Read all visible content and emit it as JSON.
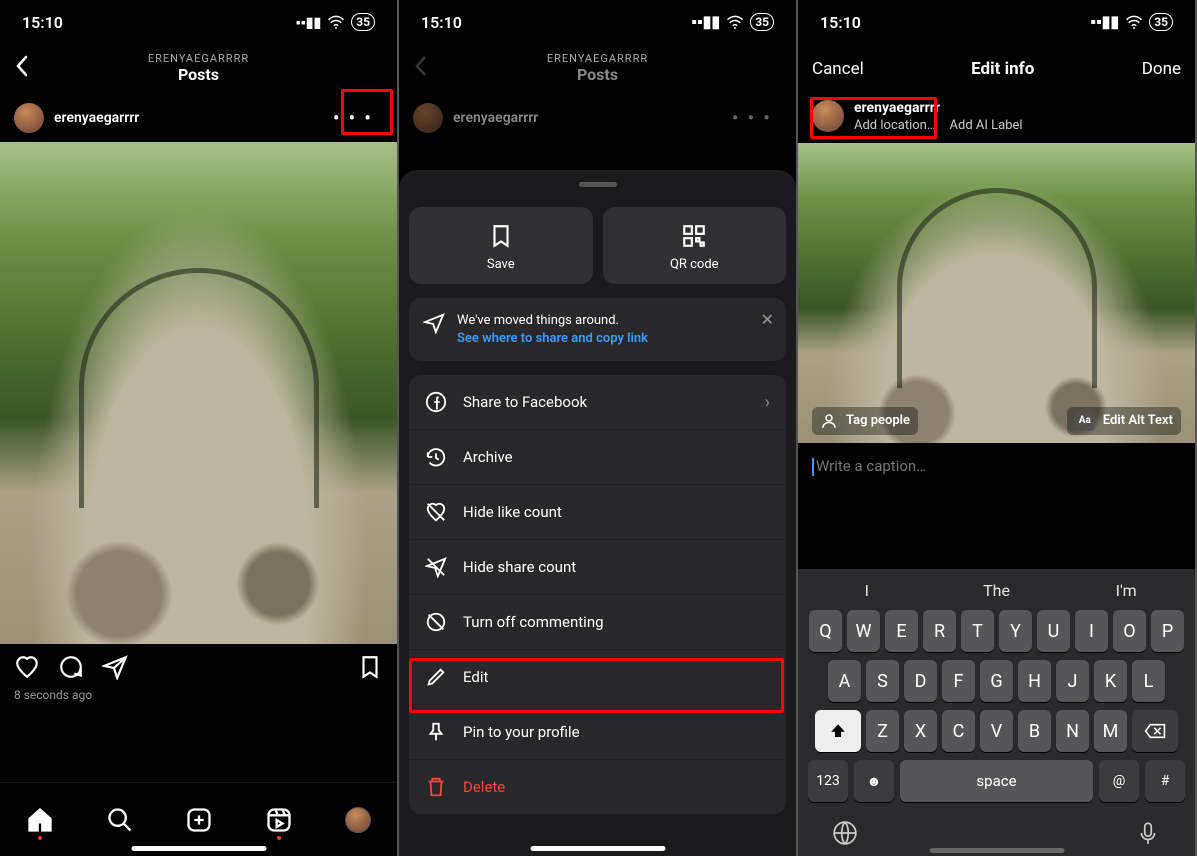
{
  "status": {
    "time": "15:10",
    "battery": "35"
  },
  "screen1": {
    "nav_sub": "ERENYAEGARRRR",
    "nav_title": "Posts",
    "username": "erenyaegarrrr",
    "timestamp": "8 seconds ago"
  },
  "screen2": {
    "nav_sub": "ERENYAEGARRRR",
    "nav_title": "Posts",
    "username": "erenyaegarrrr",
    "top_buttons": {
      "save": "Save",
      "qr": "QR code"
    },
    "notice_line1": "We've moved things around.",
    "notice_link": "See where to share and copy link",
    "items": {
      "share_fb": "Share to Facebook",
      "archive": "Archive",
      "hide_likes": "Hide like count",
      "hide_shares": "Hide share count",
      "turn_off_comment": "Turn off commenting",
      "edit": "Edit",
      "pin": "Pin to your profile",
      "delete": "Delete"
    }
  },
  "screen3": {
    "cancel": "Cancel",
    "title": "Edit info",
    "done": "Done",
    "username": "erenyaegarrrr",
    "add_location": "Add location…",
    "add_ai": "Add AI Label",
    "tag_people": "Tag people",
    "edit_alt": "Edit Alt Text",
    "caption_placeholder": "Write a caption…",
    "suggestions": [
      "I",
      "The",
      "I'm"
    ],
    "row1": [
      "Q",
      "W",
      "E",
      "R",
      "T",
      "Y",
      "U",
      "I",
      "O",
      "P"
    ],
    "row2": [
      "A",
      "S",
      "D",
      "F",
      "G",
      "H",
      "J",
      "K",
      "L"
    ],
    "row3": [
      "Z",
      "X",
      "C",
      "V",
      "B",
      "N",
      "M"
    ],
    "key_123": "123",
    "key_space": "space",
    "key_at": "@",
    "key_hash": "#"
  }
}
